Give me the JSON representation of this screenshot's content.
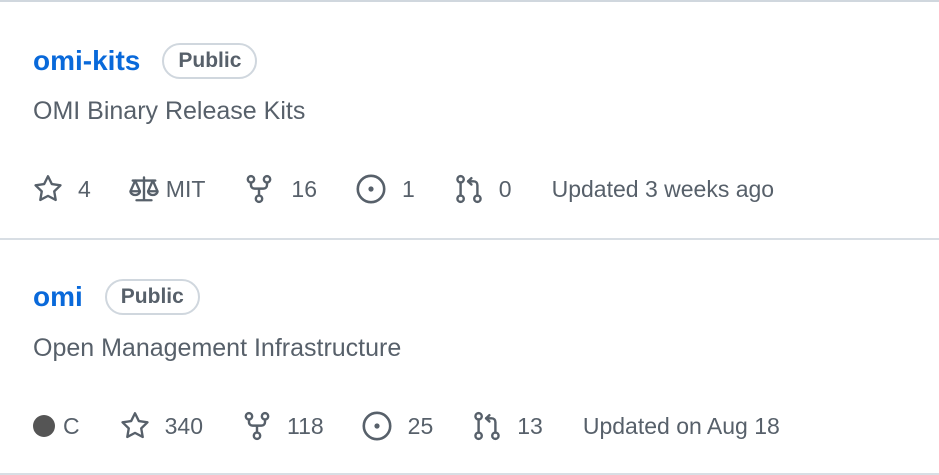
{
  "repos": [
    {
      "name": "omi-kits",
      "visibility": "Public",
      "description": "OMI Binary Release Kits",
      "stars": "4",
      "license": "MIT",
      "forks": "16",
      "issues": "1",
      "pull_requests": "0",
      "updated": "Updated 3 weeks ago"
    },
    {
      "name": "omi",
      "visibility": "Public",
      "description": "Open Management Infrastructure",
      "language": "C",
      "language_color": "#555555",
      "stars": "340",
      "forks": "118",
      "issues": "25",
      "pull_requests": "13",
      "updated": "Updated on Aug 18"
    }
  ],
  "icons": {
    "star": "star-icon",
    "license": "law-icon",
    "fork": "repo-forked-icon",
    "issue": "issue-opened-icon",
    "pull_request": "git-pull-request-icon"
  },
  "colors": {
    "link": "#0969da",
    "muted": "#57606a",
    "border": "#d0d7de"
  }
}
